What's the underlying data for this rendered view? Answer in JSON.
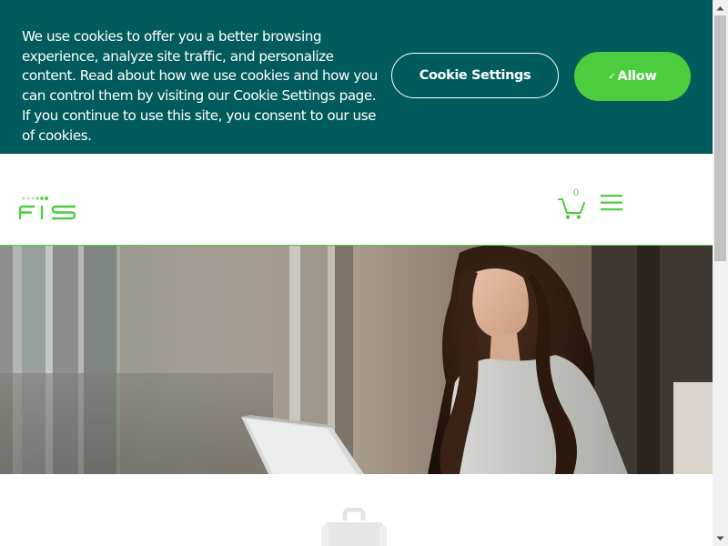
{
  "cookie_banner": {
    "message": "We use cookies to offer you a better browsing experience, analyze site traffic, and personalize content. Read about how we use cookies and how you can control them by visiting our Cookie Settings page. If you continue to use this site, you consent to our use of cookies.",
    "settings_button_label": "Cookie Settings",
    "allow_button_label": "Allow",
    "allow_check_glyph": "✓"
  },
  "header": {
    "logo_alt": "FIS",
    "cart_count": "0",
    "cart_icon": "shopping-cart-icon",
    "menu_icon": "hamburger-menu-icon"
  },
  "hero": {
    "image_description_icon": "hero-photo"
  },
  "content": {
    "icon": "briefcase-icon"
  },
  "colors": {
    "banner_bg": "#015b5c",
    "accent_green": "#4bcd3e",
    "white": "#ffffff"
  }
}
